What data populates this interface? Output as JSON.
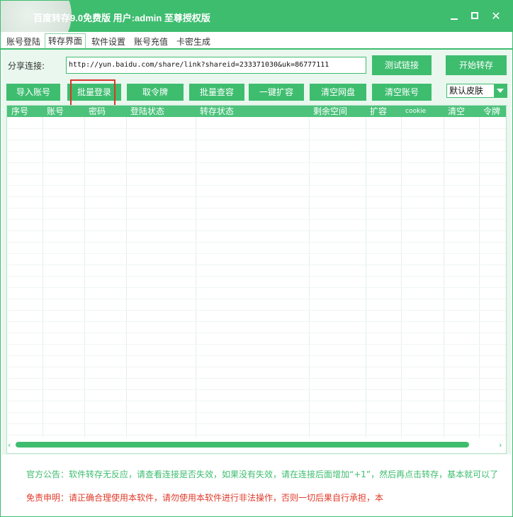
{
  "window": {
    "title": "百度转存9.0免费版 用户:admin 至尊授权版",
    "accent_color": "#3ebd6f",
    "controls": {
      "minimize_icon": "minimize-icon",
      "maximize_icon": "maximize-icon",
      "close_icon": "close-icon",
      "close_label": "✕"
    }
  },
  "tabs": [
    {
      "label": "账号登陆"
    },
    {
      "label": "转存界面"
    },
    {
      "label": "软件设置"
    },
    {
      "label": "账号充值"
    },
    {
      "label": "卡密生成"
    }
  ],
  "share": {
    "label": "分享连接:",
    "value": "http://yun.baidu.com/share/link?shareid=233371030&uk=86777111"
  },
  "buttons": {
    "test_link": "测试链接",
    "start_transfer": "开始转存",
    "import_accounts": "导入账号",
    "batch_login": "批量登录",
    "get_token": "取令牌",
    "batch_check_capacity": "批量查容",
    "one_click_expand": "一键扩容",
    "clear_disk": "清空网盘",
    "clear_accounts": "清空账号"
  },
  "skin": {
    "selected": "默认皮肤"
  },
  "table": {
    "columns": [
      "序号",
      "账号",
      "密码",
      "登陆状态",
      "转存状态",
      "剩余空间",
      "扩容",
      "cookie",
      "清空",
      "令牌"
    ],
    "rows": []
  },
  "footer": {
    "notice": "官方公告：软件转存无反应，请查看连接是否失效，如果没有失效，请在连接后面增加“+1”，然后再点击转存，基本就可以了",
    "disclaimer": "免责申明：请正确合理使用本软件，请勿使用本软件进行非法操作，否则一切后果自行承担，本",
    "notice_color": "#3ebd6f",
    "disclaimer_color": "#e03a2a"
  },
  "highlight_color": "#d9362b"
}
